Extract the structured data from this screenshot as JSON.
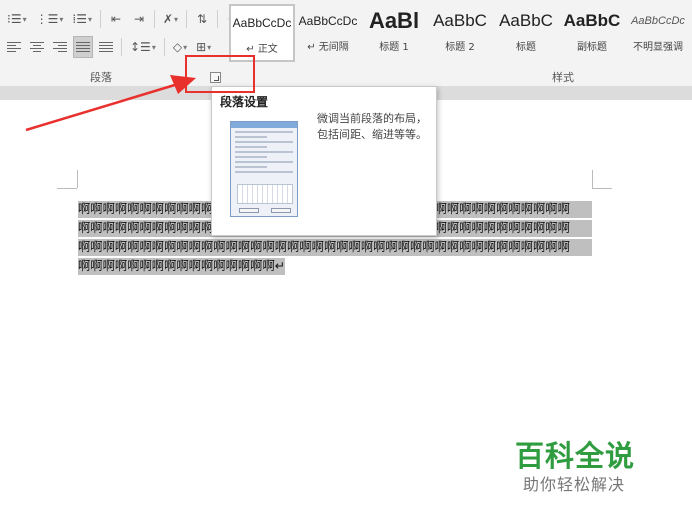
{
  "ribbon": {
    "paragraph_group_label": "段落",
    "styles_group_label": "样式",
    "styles": [
      {
        "preview": "AaBbCcDc",
        "name": "↵ 正文",
        "selected": true
      },
      {
        "preview": "AaBbCcDc",
        "name": "↵ 无间隔"
      },
      {
        "preview": "AaBl",
        "name": "标题 1"
      },
      {
        "preview": "AaBbC",
        "name": "标题 2"
      },
      {
        "preview": "AaBbC",
        "name": "标题"
      },
      {
        "preview": "AaBbC",
        "name": "副标题"
      },
      {
        "preview": "AaBbCcDc",
        "name": "不明显强调"
      }
    ]
  },
  "tooltip": {
    "title": "段落设置",
    "description": "微调当前段落的布局，包括间距、缩进等等。"
  },
  "document": {
    "lines": [
      "啊啊啊啊啊啊啊啊啊啊啊啊啊啊啊啊啊啊啊啊啊啊啊啊啊啊啊啊啊啊啊啊啊啊啊啊啊啊啊啊",
      "啊啊啊啊啊啊啊啊啊啊啊啊啊啊啊啊啊啊啊啊啊啊啊啊啊啊啊啊啊啊啊啊啊啊啊啊啊啊啊啊",
      "啊啊啊啊啊啊啊啊啊啊啊啊啊啊啊啊啊啊啊啊啊啊啊啊啊啊啊啊啊啊啊啊啊啊啊啊啊啊啊啊",
      "啊啊啊啊啊啊啊啊啊啊啊啊啊啊啊啊↵"
    ]
  },
  "watermark": {
    "title": "百科全说",
    "subtitle": "助你轻松解决"
  },
  "colors": {
    "highlight_box": "#e8302c",
    "watermark_green": "#2e9c3f",
    "selection_gray": "#bfbfbf"
  },
  "icons": [
    "bullets-icon",
    "numbering-icon",
    "multilevel-list-icon",
    "decrease-indent-icon",
    "increase-indent-icon",
    "chinese-layout-icon",
    "sort-icon",
    "show-marks-icon",
    "align-left-icon",
    "align-center-icon",
    "align-right-icon",
    "justify-icon",
    "distributed-icon",
    "line-spacing-icon",
    "shading-icon",
    "borders-icon",
    "dialog-launcher-icon"
  ]
}
